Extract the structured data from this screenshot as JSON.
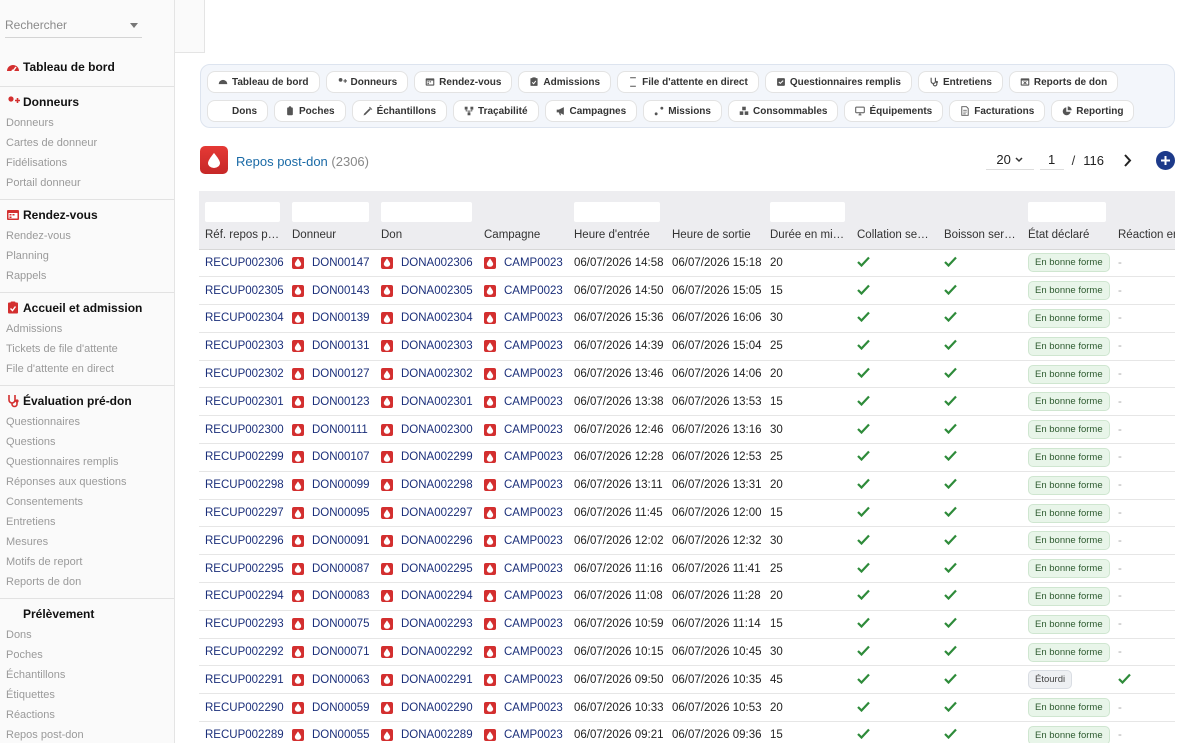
{
  "sidebar": {
    "search_placeholder": "Rechercher",
    "top": {
      "title": "Tableau de bord"
    },
    "sections": [
      {
        "title": "Donneurs",
        "icon": "user-plus-icon",
        "items": [
          "Donneurs",
          "Cartes de donneur",
          "Fidélisations",
          "Portail donneur"
        ]
      },
      {
        "title": "Rendez-vous",
        "icon": "calendar-icon",
        "items": [
          "Rendez-vous",
          "Planning",
          "Rappels"
        ]
      },
      {
        "title": "Accueil et admission",
        "icon": "clipboard-icon",
        "items": [
          "Admissions",
          "Tickets de file d'attente",
          "File d'attente en direct"
        ]
      },
      {
        "title": "Évaluation pré-don",
        "icon": "stethoscope-icon",
        "items": [
          "Questionnaires",
          "Questions",
          "Questionnaires remplis",
          "Réponses aux questions",
          "Consentements",
          "Entretiens",
          "Mesures",
          "Motifs de report",
          "Reports de don"
        ]
      },
      {
        "title": "Prélèvement",
        "icon": "droplet-icon",
        "items": [
          "Dons",
          "Poches",
          "Échantillons",
          "Étiquettes",
          "Réactions",
          "Repos post-don"
        ]
      }
    ]
  },
  "chips": [
    {
      "label": "Tableau de bord",
      "icon": "gauge-icon"
    },
    {
      "label": "Donneurs",
      "icon": "user-plus-icon"
    },
    {
      "label": "Rendez-vous",
      "icon": "calendar-icon"
    },
    {
      "label": "Admissions",
      "icon": "clipboard-icon"
    },
    {
      "label": "File d'attente en direct",
      "icon": "hourglass-icon"
    },
    {
      "label": "Questionnaires remplis",
      "icon": "checklist-icon"
    },
    {
      "label": "Entretiens",
      "icon": "stethoscope-icon"
    },
    {
      "label": "Reports de don",
      "icon": "calendar-x-icon"
    },
    {
      "label": "Dons",
      "icon": "droplet-icon"
    },
    {
      "label": "Poches",
      "icon": "bag-icon"
    },
    {
      "label": "Échantillons",
      "icon": "syringe-icon"
    },
    {
      "label": "Traçabilité",
      "icon": "diagram-icon"
    },
    {
      "label": "Campagnes",
      "icon": "megaphone-icon"
    },
    {
      "label": "Missions",
      "icon": "route-icon"
    },
    {
      "label": "Consommables",
      "icon": "boxes-icon"
    },
    {
      "label": "Équipements",
      "icon": "monitor-icon"
    },
    {
      "label": "Facturations",
      "icon": "invoice-icon"
    },
    {
      "label": "Reporting",
      "icon": "pie-icon"
    }
  ],
  "header": {
    "title": "Repos post-don",
    "count": "(2306)",
    "per_page": "20",
    "page": "1",
    "separator": "/",
    "total_pages": "116"
  },
  "table": {
    "columns": [
      "Réf. repos p…",
      "Donneur",
      "Don",
      "Campagne",
      "Heure d'entrée",
      "Heure de sortie",
      "Durée en mi…",
      "Collation ser…",
      "Boisson servie",
      "État déclaré",
      "Réaction en"
    ],
    "rows": [
      {
        "ref": "RECUP002306",
        "donneur": "DON00147",
        "don": "DONA002306",
        "campagne": "CAMP0023",
        "entree": "06/07/2026 14:58",
        "sortie": "06/07/2026 15:18",
        "duree": "20",
        "etat": "En bonne forme",
        "reaction": "-"
      },
      {
        "ref": "RECUP002305",
        "donneur": "DON00143",
        "don": "DONA002305",
        "campagne": "CAMP0023",
        "entree": "06/07/2026 14:50",
        "sortie": "06/07/2026 15:05",
        "duree": "15",
        "etat": "En bonne forme",
        "reaction": "-"
      },
      {
        "ref": "RECUP002304",
        "donneur": "DON00139",
        "don": "DONA002304",
        "campagne": "CAMP0023",
        "entree": "06/07/2026 15:36",
        "sortie": "06/07/2026 16:06",
        "duree": "30",
        "etat": "En bonne forme",
        "reaction": "-"
      },
      {
        "ref": "RECUP002303",
        "donneur": "DON00131",
        "don": "DONA002303",
        "campagne": "CAMP0023",
        "entree": "06/07/2026 14:39",
        "sortie": "06/07/2026 15:04",
        "duree": "25",
        "etat": "En bonne forme",
        "reaction": "-"
      },
      {
        "ref": "RECUP002302",
        "donneur": "DON00127",
        "don": "DONA002302",
        "campagne": "CAMP0023",
        "entree": "06/07/2026 13:46",
        "sortie": "06/07/2026 14:06",
        "duree": "20",
        "etat": "En bonne forme",
        "reaction": "-"
      },
      {
        "ref": "RECUP002301",
        "donneur": "DON00123",
        "don": "DONA002301",
        "campagne": "CAMP0023",
        "entree": "06/07/2026 13:38",
        "sortie": "06/07/2026 13:53",
        "duree": "15",
        "etat": "En bonne forme",
        "reaction": "-"
      },
      {
        "ref": "RECUP002300",
        "donneur": "DON00111",
        "don": "DONA002300",
        "campagne": "CAMP0023",
        "entree": "06/07/2026 12:46",
        "sortie": "06/07/2026 13:16",
        "duree": "30",
        "etat": "En bonne forme",
        "reaction": "-"
      },
      {
        "ref": "RECUP002299",
        "donneur": "DON00107",
        "don": "DONA002299",
        "campagne": "CAMP0023",
        "entree": "06/07/2026 12:28",
        "sortie": "06/07/2026 12:53",
        "duree": "25",
        "etat": "En bonne forme",
        "reaction": "-"
      },
      {
        "ref": "RECUP002298",
        "donneur": "DON00099",
        "don": "DONA002298",
        "campagne": "CAMP0023",
        "entree": "06/07/2026 13:11",
        "sortie": "06/07/2026 13:31",
        "duree": "20",
        "etat": "En bonne forme",
        "reaction": "-"
      },
      {
        "ref": "RECUP002297",
        "donneur": "DON00095",
        "don": "DONA002297",
        "campagne": "CAMP0023",
        "entree": "06/07/2026 11:45",
        "sortie": "06/07/2026 12:00",
        "duree": "15",
        "etat": "En bonne forme",
        "reaction": "-"
      },
      {
        "ref": "RECUP002296",
        "donneur": "DON00091",
        "don": "DONA002296",
        "campagne": "CAMP0023",
        "entree": "06/07/2026 12:02",
        "sortie": "06/07/2026 12:32",
        "duree": "30",
        "etat": "En bonne forme",
        "reaction": "-"
      },
      {
        "ref": "RECUP002295",
        "donneur": "DON00087",
        "don": "DONA002295",
        "campagne": "CAMP0023",
        "entree": "06/07/2026 11:16",
        "sortie": "06/07/2026 11:41",
        "duree": "25",
        "etat": "En bonne forme",
        "reaction": "-"
      },
      {
        "ref": "RECUP002294",
        "donneur": "DON00083",
        "don": "DONA002294",
        "campagne": "CAMP0023",
        "entree": "06/07/2026 11:08",
        "sortie": "06/07/2026 11:28",
        "duree": "20",
        "etat": "En bonne forme",
        "reaction": "-"
      },
      {
        "ref": "RECUP002293",
        "donneur": "DON00075",
        "don": "DONA002293",
        "campagne": "CAMP0023",
        "entree": "06/07/2026 10:59",
        "sortie": "06/07/2026 11:14",
        "duree": "15",
        "etat": "En bonne forme",
        "reaction": "-"
      },
      {
        "ref": "RECUP002292",
        "donneur": "DON00071",
        "don": "DONA002292",
        "campagne": "CAMP0023",
        "entree": "06/07/2026 10:15",
        "sortie": "06/07/2026 10:45",
        "duree": "30",
        "etat": "En bonne forme",
        "reaction": "-"
      },
      {
        "ref": "RECUP002291",
        "donneur": "DON00063",
        "don": "DONA002291",
        "campagne": "CAMP0023",
        "entree": "06/07/2026 09:50",
        "sortie": "06/07/2026 10:35",
        "duree": "45",
        "etat": "Étourdi",
        "reaction": "check"
      },
      {
        "ref": "RECUP002290",
        "donneur": "DON00059",
        "don": "DONA002290",
        "campagne": "CAMP0023",
        "entree": "06/07/2026 10:33",
        "sortie": "06/07/2026 10:53",
        "duree": "20",
        "etat": "En bonne forme",
        "reaction": "-"
      },
      {
        "ref": "RECUP002289",
        "donneur": "DON00055",
        "don": "DONA002289",
        "campagne": "CAMP0023",
        "entree": "06/07/2026 09:21",
        "sortie": "06/07/2026 09:36",
        "duree": "15",
        "etat": "En bonne forme",
        "reaction": "-"
      }
    ]
  },
  "colors": {
    "accent": "#1d3a8a",
    "link": "#1b2f7a",
    "danger": "#d32f2f",
    "success": "#2e8b3a"
  }
}
